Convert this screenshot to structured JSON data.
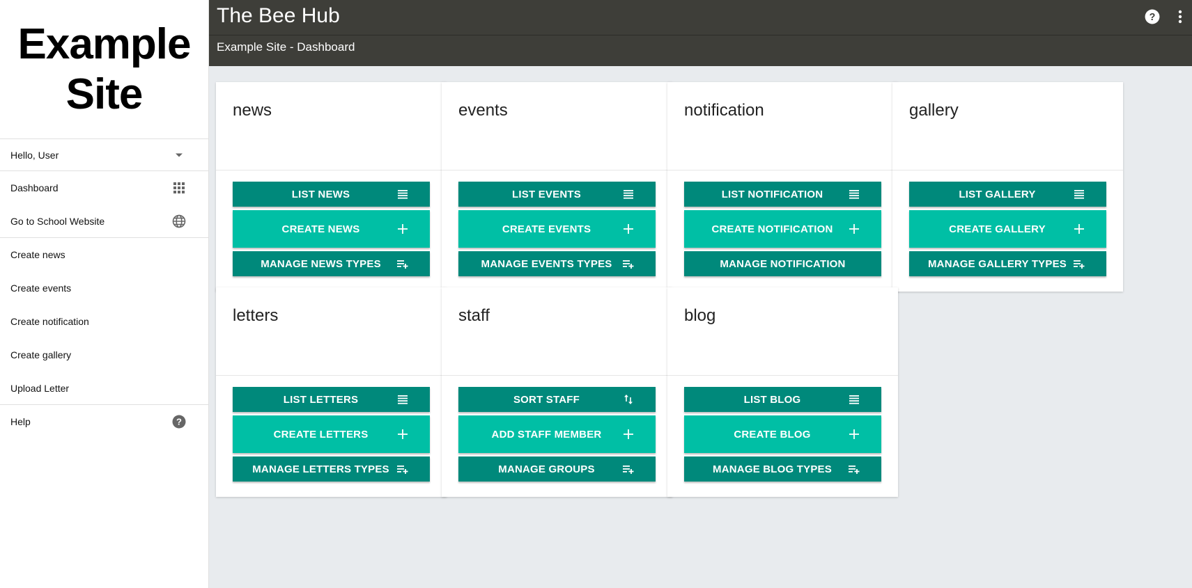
{
  "sidebar": {
    "logo_text": "Example Site",
    "user_greeting": "Hello, User",
    "nav": [
      {
        "label": "Dashboard",
        "icon": "grid-icon"
      },
      {
        "label": "Go to School Website",
        "icon": "globe-icon"
      }
    ],
    "create_links": [
      "Create news",
      "Create events",
      "Create notification",
      "Create gallery",
      "Upload Letter"
    ],
    "help_label": "Help"
  },
  "header": {
    "app_title": "The Bee Hub",
    "subtitle": "Example Site - Dashboard",
    "help_icon": "help-circle-icon",
    "menu_icon": "more-vert-icon"
  },
  "colors": {
    "header_bg": "#3e3e39",
    "button_dark": "#00897b",
    "button_light": "#00bfa5",
    "page_bg": "#e8ebee"
  },
  "cards": [
    {
      "title": "news",
      "buttons": [
        {
          "label": "LIST NEWS",
          "icon": "list-icon",
          "style": "dark"
        },
        {
          "label": "CREATE NEWS",
          "icon": "plus-icon",
          "style": "light"
        },
        {
          "label": "MANAGE NEWS TYPES",
          "icon": "playlist-add-icon",
          "style": "dark"
        }
      ]
    },
    {
      "title": "events",
      "buttons": [
        {
          "label": "LIST EVENTS",
          "icon": "list-icon",
          "style": "dark"
        },
        {
          "label": "CREATE EVENTS",
          "icon": "plus-icon",
          "style": "light"
        },
        {
          "label": "MANAGE EVENTS TYPES",
          "icon": "playlist-add-icon",
          "style": "dark"
        }
      ]
    },
    {
      "title": "notification",
      "buttons": [
        {
          "label": "LIST NOTIFICATION",
          "icon": "list-icon",
          "style": "dark"
        },
        {
          "label": "CREATE NOTIFICATION",
          "icon": "plus-icon",
          "style": "light"
        },
        {
          "label": "MANAGE NOTIFICATION",
          "icon": "",
          "style": "dark"
        }
      ]
    },
    {
      "title": "gallery",
      "buttons": [
        {
          "label": "LIST GALLERY",
          "icon": "list-icon",
          "style": "dark"
        },
        {
          "label": "CREATE GALLERY",
          "icon": "plus-icon",
          "style": "light"
        },
        {
          "label": "MANAGE GALLERY TYPES",
          "icon": "playlist-add-icon",
          "style": "dark"
        }
      ]
    },
    {
      "title": "letters",
      "buttons": [
        {
          "label": "LIST LETTERS",
          "icon": "list-icon",
          "style": "dark"
        },
        {
          "label": "CREATE LETTERS",
          "icon": "plus-icon",
          "style": "light"
        },
        {
          "label": "MANAGE LETTERS TYPES",
          "icon": "playlist-add-icon",
          "style": "dark"
        }
      ]
    },
    {
      "title": "staff",
      "buttons": [
        {
          "label": "SORT STAFF",
          "icon": "sort-icon",
          "style": "dark"
        },
        {
          "label": "ADD STAFF MEMBER",
          "icon": "plus-icon",
          "style": "light"
        },
        {
          "label": "MANAGE GROUPS",
          "icon": "playlist-add-icon",
          "style": "dark"
        }
      ]
    },
    {
      "title": "blog",
      "buttons": [
        {
          "label": "LIST BLOG",
          "icon": "list-icon",
          "style": "dark"
        },
        {
          "label": "CREATE BLOG",
          "icon": "plus-icon",
          "style": "light"
        },
        {
          "label": "MANAGE BLOG TYPES",
          "icon": "playlist-add-icon",
          "style": "dark"
        }
      ]
    }
  ]
}
